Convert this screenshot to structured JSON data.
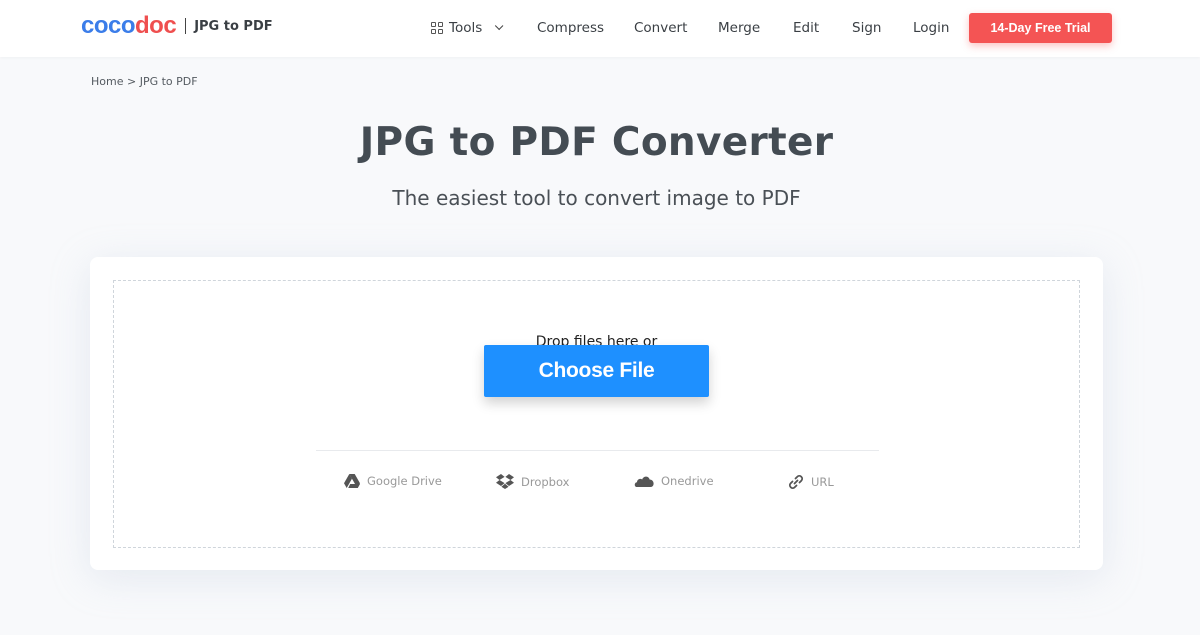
{
  "header": {
    "logo": {
      "part1": "coco",
      "part2": "doc",
      "subtitle": "JPG to PDF"
    },
    "nav": [
      {
        "label": "Tools",
        "icon": "grid-icon",
        "has_dropdown": true
      },
      {
        "label": "Compress"
      },
      {
        "label": "Convert"
      },
      {
        "label": "Merge"
      },
      {
        "label": "Edit"
      },
      {
        "label": "Sign"
      },
      {
        "label": "Login"
      }
    ],
    "cta": {
      "label": "14-Day Free Trial",
      "color": "#f45454"
    }
  },
  "breadcrumb": {
    "text": "Home > JPG to PDF"
  },
  "main": {
    "title": "JPG to PDF Converter",
    "subtitle": "The easiest tool to convert image to PDF",
    "upload": {
      "drop_label": "Drop files here or",
      "choose_button": "Choose File",
      "choose_color": "#1e90ff",
      "sources": [
        {
          "label": "Google Drive",
          "icon": "google-drive-icon"
        },
        {
          "label": "Dropbox",
          "icon": "dropbox-icon"
        },
        {
          "label": "Onedrive",
          "icon": "onedrive-icon"
        },
        {
          "label": "URL",
          "icon": "link-icon"
        }
      ]
    }
  }
}
